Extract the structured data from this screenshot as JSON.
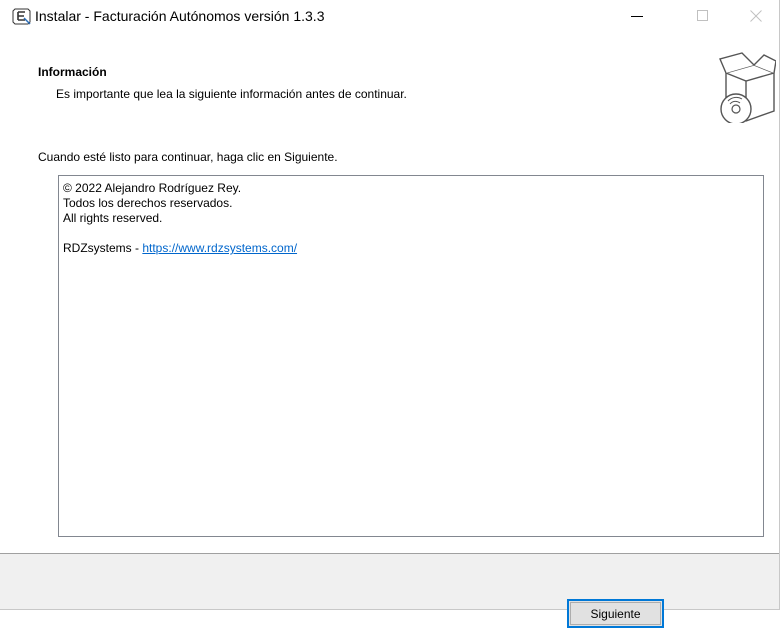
{
  "window": {
    "title": "Instalar - Facturación Autónomos versión 1.3.3",
    "controls": {
      "minimize_icon": "minimize-icon",
      "maximize_icon": "maximize-icon",
      "close_icon": "close-icon"
    }
  },
  "header": {
    "title": "Información",
    "subtitle": "Es importante que lea la siguiente información antes de continuar.",
    "image_icon": "software-box-cd-icon"
  },
  "prompt": "Cuando esté listo para continuar, haga clic en Siguiente.",
  "info_memo": {
    "line1": "© 2022 Alejandro Rodríguez Rey.",
    "line2": "Todos los derechos reservados.",
    "line3": "All rights reserved.",
    "company_prefix": "RDZsystems - ",
    "company_link": "https://www.rdzsystems.com/"
  },
  "footer": {
    "next_label": "Siguiente"
  },
  "colors": {
    "accent": "#0078d7",
    "link": "#0066cc",
    "footer_bg": "#f0f0f0"
  }
}
